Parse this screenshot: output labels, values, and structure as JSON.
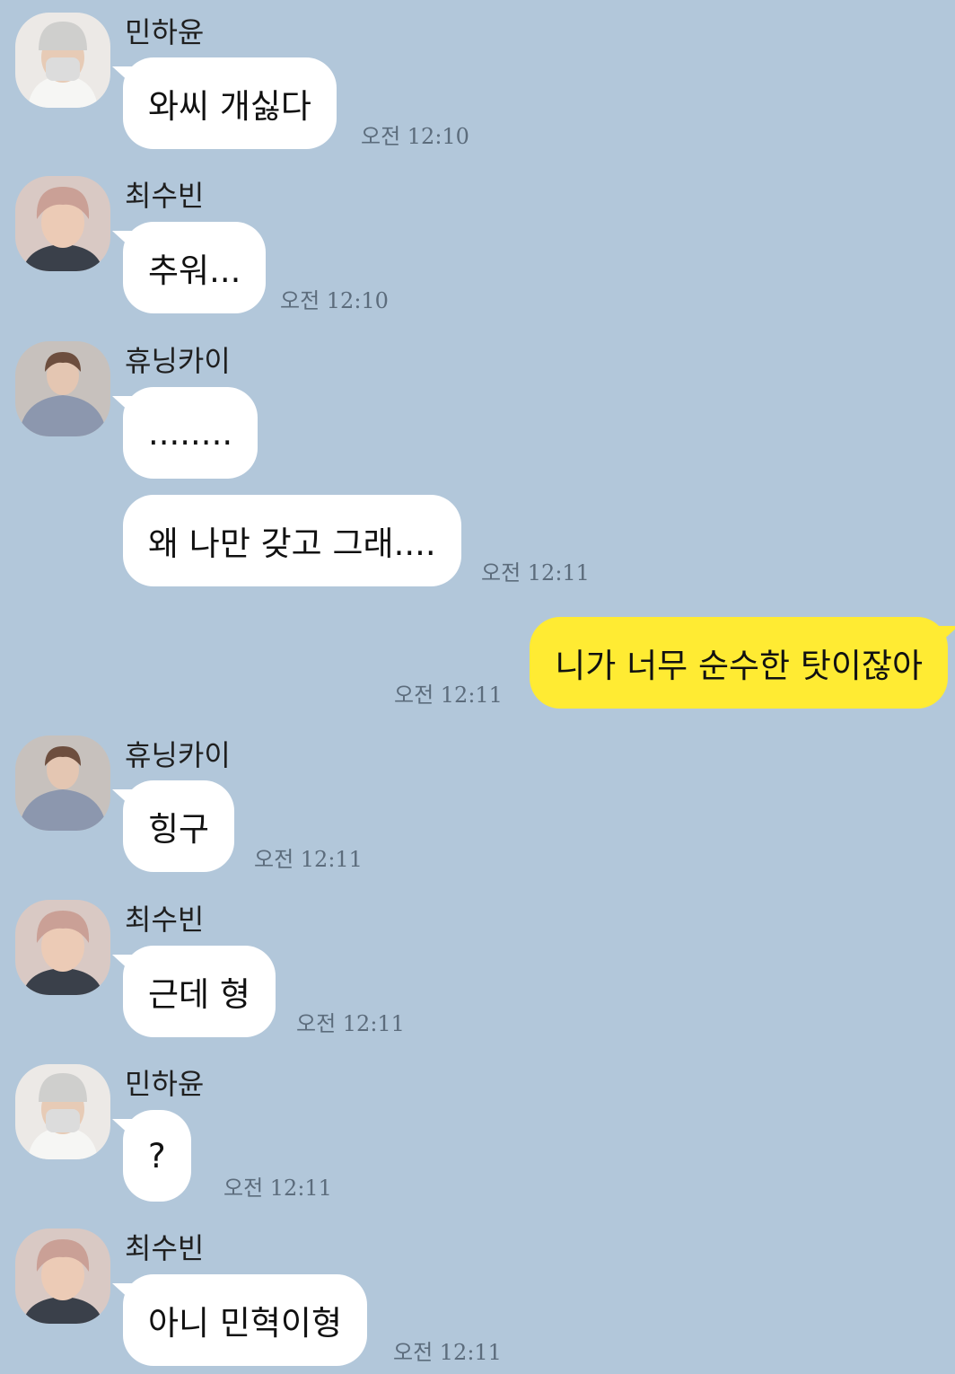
{
  "messages": [
    {
      "sender": "민하윤",
      "text": "와씨 개싫다",
      "time": "오전 12:10"
    },
    {
      "sender": "최수빈",
      "text": "추워...",
      "time": "오전 12:10"
    },
    {
      "sender": "휴닝카이",
      "text": "........"
    },
    {
      "text": "왜 나만 갖고 그래....",
      "time": "오전 12:11"
    },
    {
      "text": "니가 너무 순수한 탓이잖아",
      "time": "오전 12:11"
    },
    {
      "sender": "휴닝카이",
      "text": "힝구",
      "time": "오전 12:11"
    },
    {
      "sender": "최수빈",
      "text": "근데 형",
      "time": "오전 12:11"
    },
    {
      "sender": "민하윤",
      "text": "?",
      "time": "오전 12:11"
    },
    {
      "sender": "최수빈",
      "text": "아니 민혁이형",
      "time": "오전 12:11"
    }
  ],
  "colors": {
    "background": "#b2c7da",
    "incoming_bubble": "#ffffff",
    "outgoing_bubble": "#ffeb33",
    "timestamp": "#5c6c7c"
  },
  "icons": {
    "minhayun": "avatar-masked-beanie-icon",
    "choisoobin": "avatar-pink-hair-icon",
    "hueningkai": "avatar-gray-sweater-icon"
  }
}
